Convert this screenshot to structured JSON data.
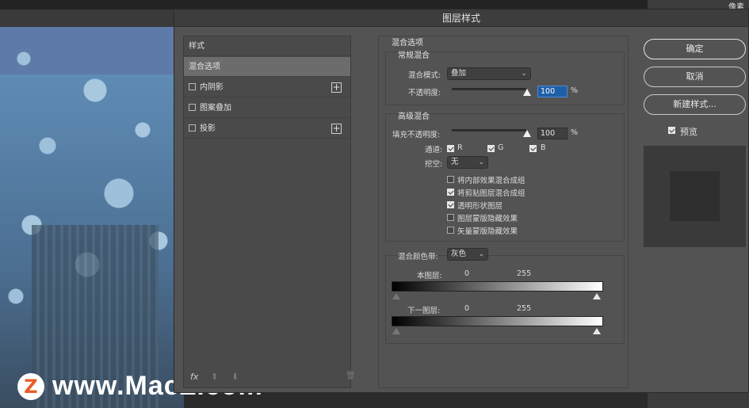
{
  "background": {
    "right_panel_label": "像素",
    "watermark_logo": "Z",
    "watermark_text": "www.MacZ.com"
  },
  "dialog": {
    "title": "图层样式",
    "styles_list": {
      "header": "样式",
      "items": [
        {
          "label": "混合选项",
          "selected": true,
          "checkbox": false,
          "plus": false
        },
        {
          "label": "内阴影",
          "selected": false,
          "checkbox": true,
          "checked": false,
          "plus": true
        },
        {
          "label": "图案叠加",
          "selected": false,
          "checkbox": true,
          "checked": false,
          "plus": false
        },
        {
          "label": "投影",
          "selected": false,
          "checkbox": true,
          "checked": false,
          "plus": true
        }
      ],
      "plus_symbol": "+",
      "footer": {
        "fx": "fx",
        "up": "⬆",
        "down": "⬇",
        "trash": "🗑"
      }
    },
    "blend_options": {
      "section_title": "混合选项",
      "general": {
        "title": "常规混合",
        "mode_label": "混合模式:",
        "mode_value": "叠加",
        "opacity_label": "不透明度:",
        "opacity_value": "100",
        "percent": "%"
      },
      "advanced": {
        "title": "高级混合",
        "fill_label": "填充不透明度:",
        "fill_value": "100",
        "percent": "%",
        "channels_label": "通道:",
        "channels": [
          {
            "label": "R",
            "checked": true
          },
          {
            "label": "G",
            "checked": true
          },
          {
            "label": "B",
            "checked": true
          }
        ],
        "knockout_label": "挖空:",
        "knockout_value": "无",
        "options": [
          {
            "label": "将内部效果混合成组",
            "checked": false
          },
          {
            "label": "将剪贴图层混合成组",
            "checked": true
          },
          {
            "label": "透明形状图层",
            "checked": true
          },
          {
            "label": "图层蒙版隐藏效果",
            "checked": false
          },
          {
            "label": "矢量蒙版隐藏效果",
            "checked": false
          }
        ]
      },
      "blend_if": {
        "label": "混合颜色带:",
        "value": "灰色",
        "this_layer": {
          "label": "本图层:",
          "low": "0",
          "high": "255"
        },
        "underlying": {
          "label": "下一图层:",
          "low": "0",
          "high": "255"
        }
      }
    },
    "buttons": {
      "ok": "确定",
      "cancel": "取消",
      "new_style": "新建样式..."
    },
    "preview": {
      "label": "预览",
      "checked": true
    }
  }
}
